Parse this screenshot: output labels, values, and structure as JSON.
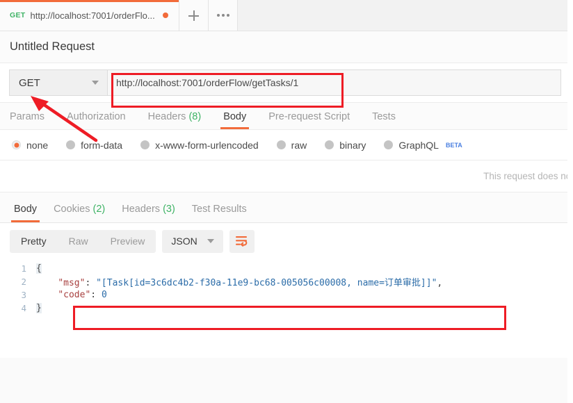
{
  "window": {
    "title": "Untitled Request"
  },
  "tabstrip": {
    "tab": {
      "method": "GET",
      "url_truncated": "http://localhost:7001/orderFlo...",
      "unsaved_dot": "•"
    },
    "new_tab_label": "+",
    "more_label": "•••"
  },
  "request": {
    "method": "GET",
    "url": "http://localhost:7001/orderFlow/getTasks/1",
    "tabs": [
      {
        "label": "Params",
        "count": "",
        "active": false
      },
      {
        "label": "Authorization",
        "count": "",
        "active": false
      },
      {
        "label": "Headers",
        "count": "(8)",
        "active": false
      },
      {
        "label": "Body",
        "count": "",
        "active": true
      },
      {
        "label": "Pre-request Script",
        "count": "",
        "active": false
      },
      {
        "label": "Tests",
        "count": "",
        "active": false
      }
    ],
    "body_types": [
      {
        "label": "none",
        "selected": true,
        "badge": ""
      },
      {
        "label": "form-data",
        "selected": false,
        "badge": ""
      },
      {
        "label": "x-www-form-urlencoded",
        "selected": false,
        "badge": ""
      },
      {
        "label": "raw",
        "selected": false,
        "badge": ""
      },
      {
        "label": "binary",
        "selected": false,
        "badge": ""
      },
      {
        "label": "GraphQL",
        "selected": false,
        "badge": "BETA"
      }
    ],
    "empty_note": "This request does not have"
  },
  "response": {
    "tabs": [
      {
        "label": "Body",
        "count": "",
        "active": true
      },
      {
        "label": "Cookies",
        "count": "(2)",
        "active": false
      },
      {
        "label": "Headers",
        "count": "(3)",
        "active": false
      },
      {
        "label": "Test Results",
        "count": "",
        "active": false
      }
    ],
    "view_modes": [
      {
        "label": "Pretty",
        "active": true
      },
      {
        "label": "Raw",
        "active": false
      },
      {
        "label": "Preview",
        "active": false
      }
    ],
    "format": "JSON",
    "wrap_icon": "word-wrap-icon",
    "code_lines": [
      {
        "number": "1",
        "open_brace": "{"
      },
      {
        "number": "2",
        "key": "\"msg\"",
        "colon": ": ",
        "value": "\"[Task[id=3c6dc4b2-f30a-11e9-bc68-005056c00008, name=订单审批]]\"",
        "comma": ","
      },
      {
        "number": "3",
        "key": "\"code\"",
        "colon": ": ",
        "value": "0",
        "comma": ""
      },
      {
        "number": "4",
        "close_brace": "}"
      }
    ]
  },
  "annotations": {
    "url_box_color": "#ee1c25",
    "msg_box_color": "#ee1c25",
    "arrow_color": "#ee1c25"
  },
  "colors": {
    "accent": "#f26b3a",
    "method_get": "#3eb365",
    "count_green": "#3eb365",
    "beta_blue": "#4a7fe0"
  }
}
